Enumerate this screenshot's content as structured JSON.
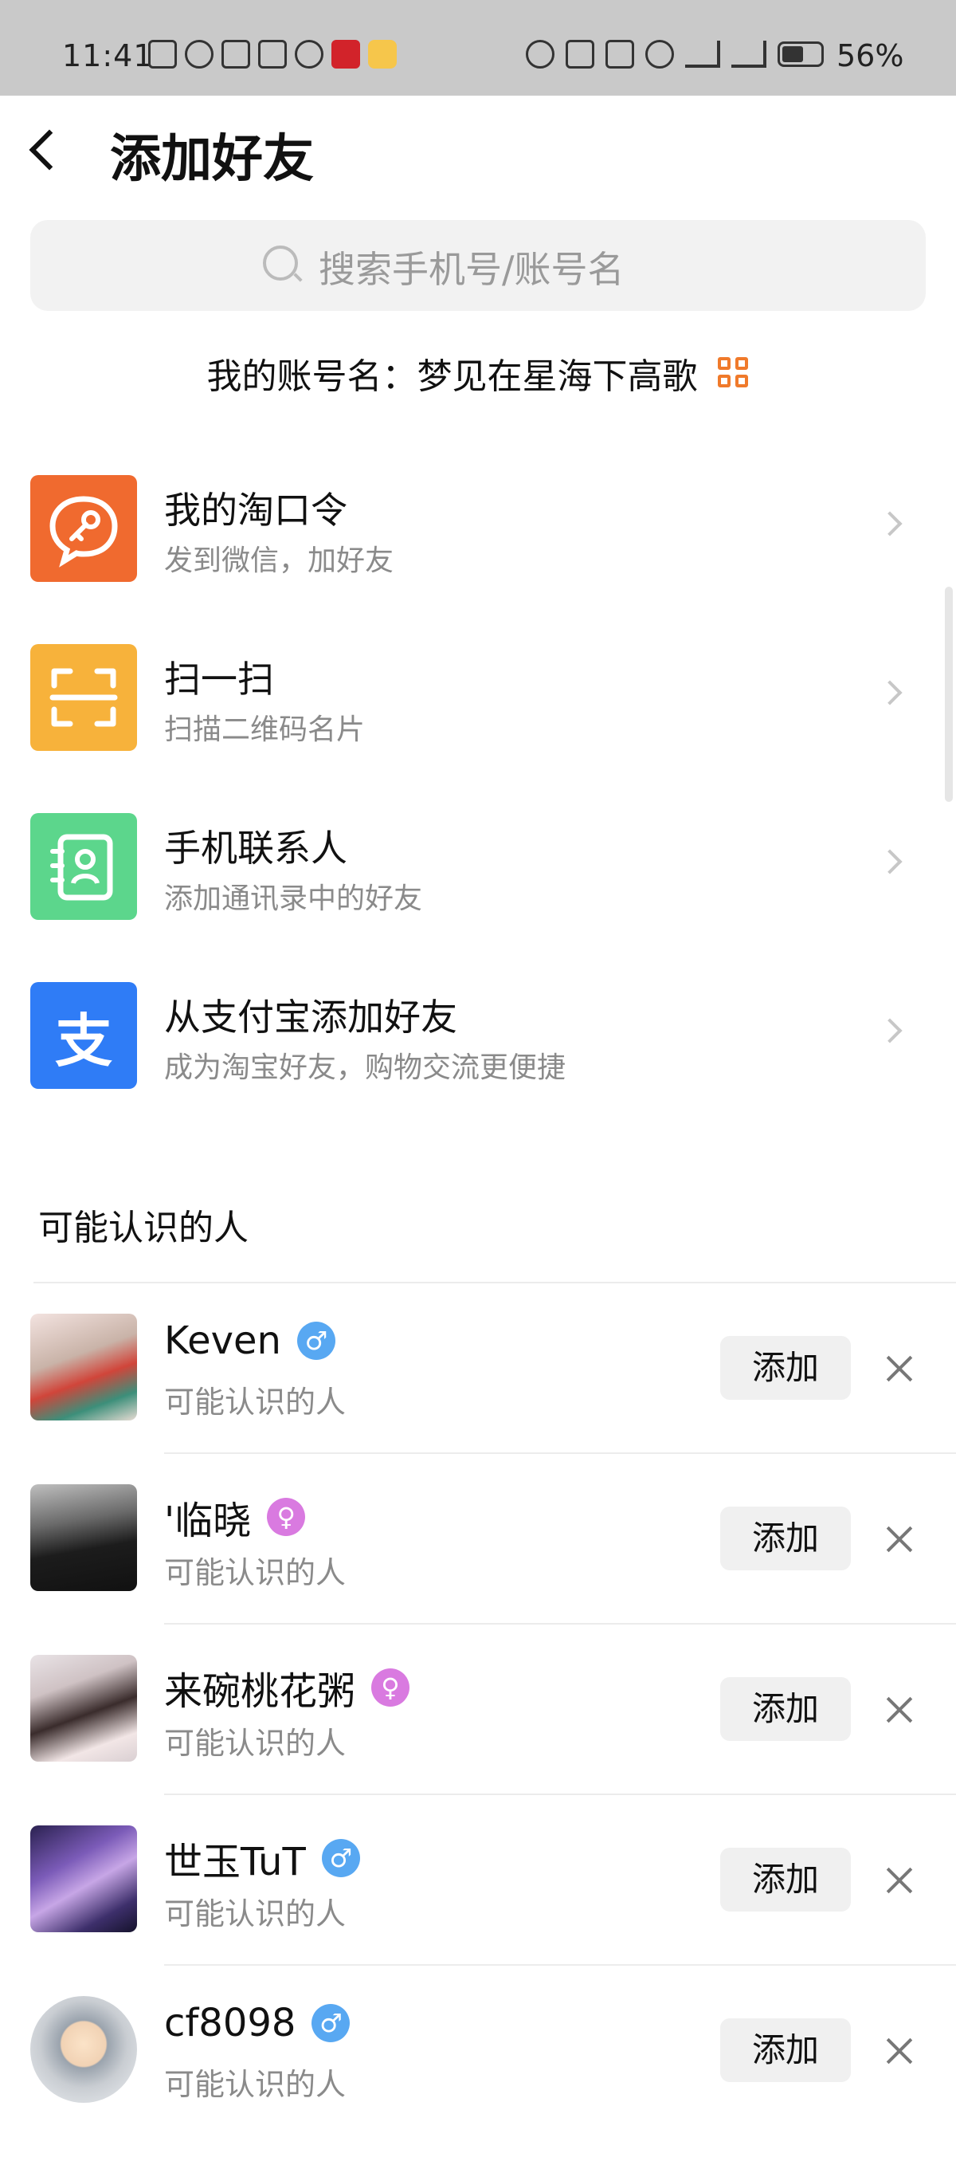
{
  "status_bar": {
    "time": "11:41",
    "battery": "56%"
  },
  "header": {
    "title": "添加好友"
  },
  "search": {
    "placeholder": "搜索手机号/账号名"
  },
  "account": {
    "label": "我的账号名：梦见在星海下高歌"
  },
  "menu": [
    {
      "title": "我的淘口令",
      "subtitle": "发到微信，加好友",
      "color": "#f06a2f",
      "icon": "key-chat-icon"
    },
    {
      "title": "扫一扫",
      "subtitle": "扫描二维码名片",
      "color": "#f7b23b",
      "icon": "scan-icon"
    },
    {
      "title": "手机联系人",
      "subtitle": "添加通讯录中的好友",
      "color": "#5cd68c",
      "icon": "contacts-icon"
    },
    {
      "title": "从支付宝添加好友",
      "subtitle": "成为淘宝好友，购物交流更便捷",
      "color": "#2f7cf6",
      "icon": "alipay-icon",
      "glyph": "支"
    }
  ],
  "section": {
    "title": "可能认识的人"
  },
  "people": [
    {
      "name": "Keven",
      "gender": "male",
      "gender_symbol": "♂",
      "subtitle": "可能认识的人",
      "add_label": "添加"
    },
    {
      "name": "'临晓",
      "gender": "female",
      "gender_symbol": "♀",
      "subtitle": "可能认识的人",
      "add_label": "添加"
    },
    {
      "name": "来碗桃花粥",
      "gender": "female",
      "gender_symbol": "♀",
      "subtitle": "可能认识的人",
      "add_label": "添加"
    },
    {
      "name": "世玉TuT",
      "gender": "male",
      "gender_symbol": "♂",
      "subtitle": "可能认识的人",
      "add_label": "添加"
    },
    {
      "name": "cf8098",
      "gender": "male",
      "gender_symbol": "♂",
      "subtitle": "可能认识的人",
      "add_label": "添加"
    }
  ]
}
